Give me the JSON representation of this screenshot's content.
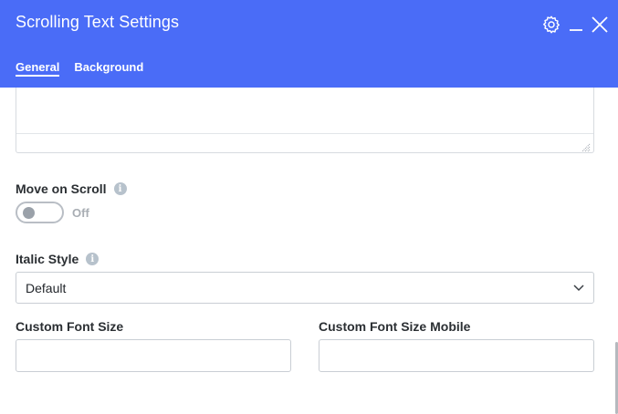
{
  "header": {
    "title": "Scrolling Text Settings",
    "background_color": "#4a6cf7",
    "icons": [
      "gear-icon",
      "minimize-icon",
      "close-icon"
    ]
  },
  "tabs": [
    {
      "label": "General",
      "active": true
    },
    {
      "label": "Background",
      "active": false
    }
  ],
  "fields": {
    "move_on_scroll": {
      "label": "Move on Scroll",
      "state_label": "Off",
      "enabled": false
    },
    "italic_style": {
      "label": "Italic Style",
      "selected": "Default"
    },
    "custom_font_size": {
      "label": "Custom Font Size",
      "value": ""
    },
    "custom_font_size_mobile": {
      "label": "Custom Font Size Mobile",
      "value": ""
    }
  },
  "info_icon_glyph": "i"
}
